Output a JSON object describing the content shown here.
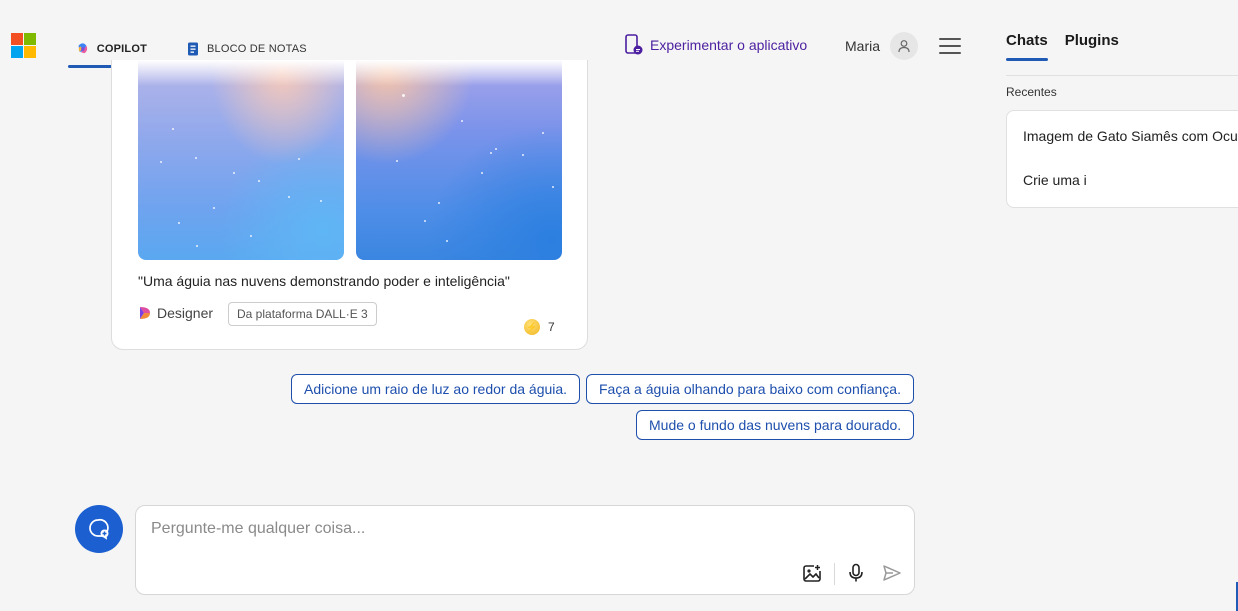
{
  "header": {
    "tabs": [
      {
        "label": "COPILOT",
        "icon": "copilot-icon",
        "active": true
      },
      {
        "label": "BLOCO DE NOTAS",
        "icon": "notebook-icon",
        "active": false
      }
    ],
    "try_app_label": "Experimentar o aplicativo",
    "user_name": "Maria"
  },
  "image_card": {
    "caption": "\"Uma águia nas nuvens demonstrando poder e inteligência\"",
    "designer_label": "Designer",
    "platform_label": "Da plataforma DALL·E 3",
    "boosts_count": "7"
  },
  "suggestions": [
    "Adicione um raio de luz ao redor da águia.",
    "Faça a águia olhando para baixo com confiança.",
    "Mude o fundo das nuvens para dourado."
  ],
  "composer": {
    "placeholder": "Pergunte-me qualquer coisa..."
  },
  "sidebar": {
    "tabs": [
      {
        "label": "Chats",
        "active": true
      },
      {
        "label": "Plugins",
        "active": false
      }
    ],
    "recent_label": "Recentes",
    "recent_items": [
      "Imagem de Gato Siamês com Oculos",
      "Crie uma i"
    ]
  },
  "colors": {
    "accent": "#1f5bb5",
    "suggestion": "#1e4fad",
    "try_app": "#4b1fa0",
    "new_topic_button": "#1b5fd1"
  }
}
